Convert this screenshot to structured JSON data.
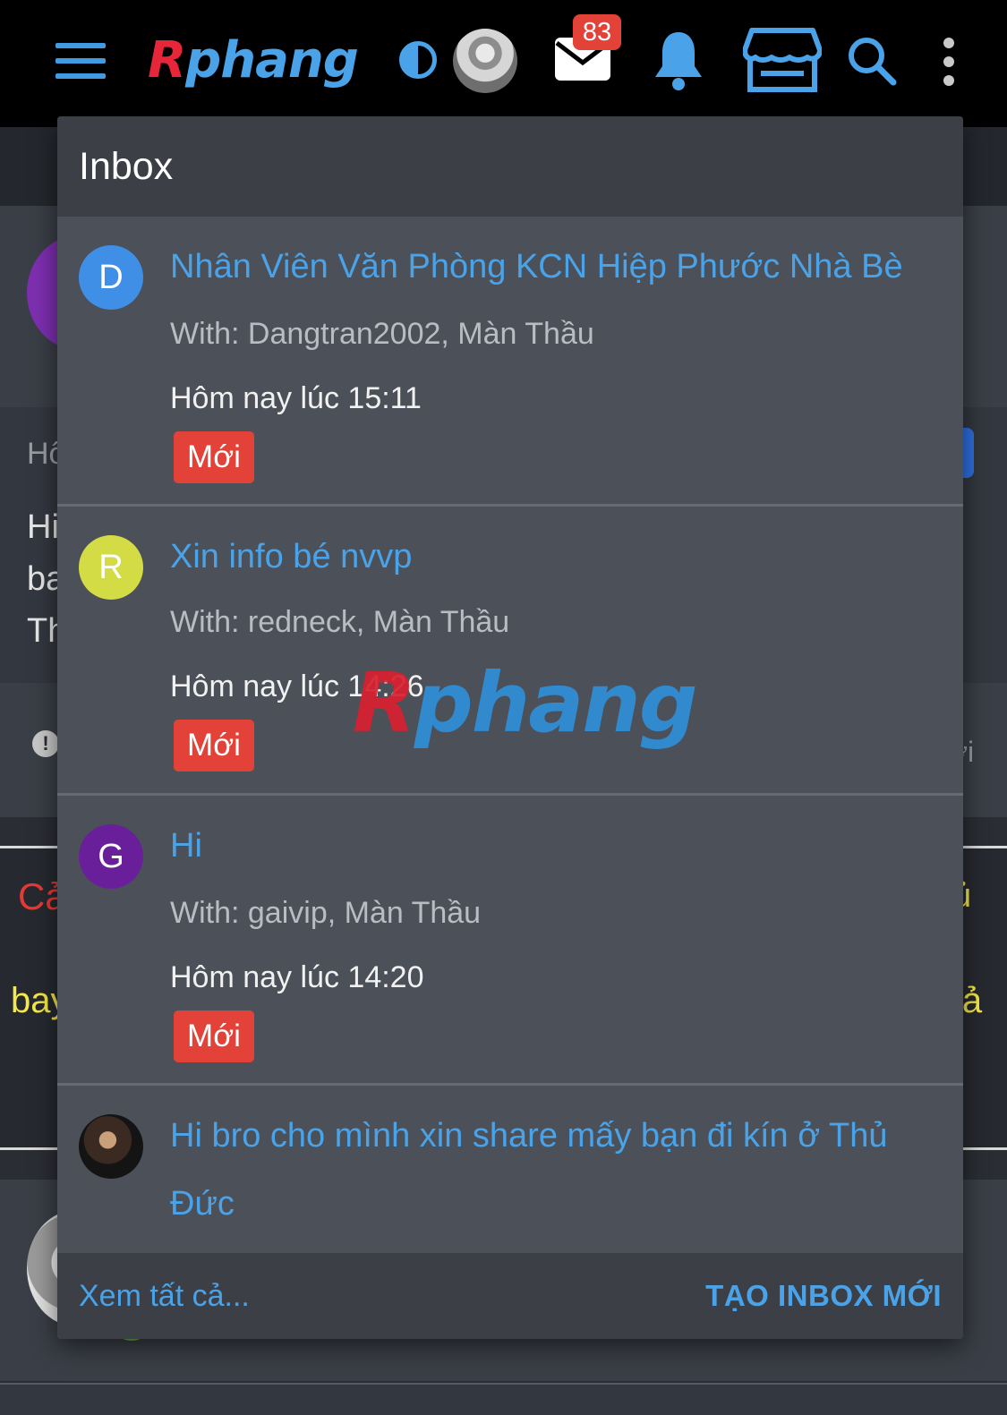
{
  "app": {
    "logo_first": "R",
    "logo_rest": "phang",
    "mail_count": "83"
  },
  "icons": {
    "menu": "hamburger-icon",
    "theme": "contrast-icon",
    "mail": "mail-icon",
    "notifications": "bell-icon",
    "store": "store-icon",
    "search": "search-icon",
    "more": "more-vertical-icon"
  },
  "colors": {
    "accent": "#4aa3e8",
    "badge": "#e24237",
    "panel": "#4c5058"
  },
  "inbox": {
    "title": "Inbox",
    "conversations": [
      {
        "initial": "D",
        "avatar_color": "#3f8fe6",
        "title": "Nhân Viên Văn Phòng KCN Hiệp Phước Nhà Bè",
        "with": "With: Dangtran2002, Màn Thầu",
        "time": "Hôm nay lúc 15:11",
        "badge": "Mới"
      },
      {
        "initial": "R",
        "avatar_color": "#d4dc45",
        "title": "Xin info bé nvvp",
        "with": "With: redneck, Màn Thầu",
        "time": "Hôm nay lúc 14:26",
        "badge": "Mới"
      },
      {
        "initial": "G",
        "avatar_color": "#6a1f9a",
        "title": "Hi",
        "with": "With: gaivip, Màn Thầu",
        "time": "Hôm nay lúc 14:20",
        "badge": "Mới"
      },
      {
        "initial": "",
        "title": "Hi bro cho mình xin share mấy bạn đi kín ở Thủ Đức"
      }
    ],
    "view_all": "Xem tất cả...",
    "new_inbox": "TẠO INBOX MỚI"
  },
  "background": {
    "fragments": [
      "Hô",
      "Hi",
      "ba",
      "Th",
      "Cả",
      "bay",
      "ủ",
      "iả",
      "ời",
      "i"
    ]
  }
}
